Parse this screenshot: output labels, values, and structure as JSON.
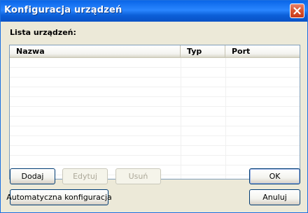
{
  "window": {
    "title": "Konfiguracja urządzeń"
  },
  "list": {
    "label": "Lista urządzeń:",
    "columns": [
      "Nazwa",
      "Typ",
      "Port"
    ],
    "rows": []
  },
  "buttons": {
    "add": "Dodaj",
    "edit": "Edytuj",
    "remove": "Usuń",
    "ok": "OK",
    "auto_config": "Automatyczna konfiguracja",
    "cancel": "Anuluj"
  },
  "icons": {
    "close": "close-icon"
  }
}
